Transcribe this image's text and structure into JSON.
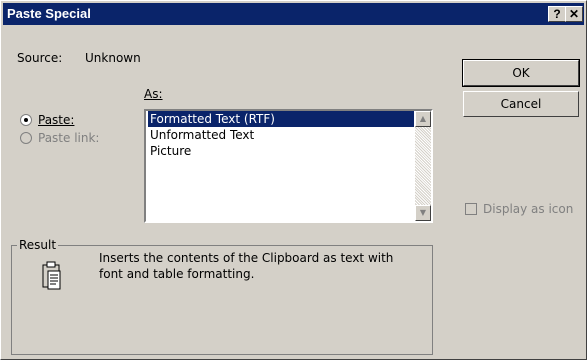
{
  "window": {
    "title": "Paste Special",
    "help_glyph": "?",
    "close_glyph": "✕"
  },
  "source": {
    "label": "Source:",
    "value": "Unknown"
  },
  "as_label": "As:",
  "options": {
    "paste": "Paste:",
    "paste_link": "Paste link:",
    "selected": "paste"
  },
  "formats": [
    "Formatted Text (RTF)",
    "Unformatted Text",
    "Picture"
  ],
  "selected_format": "Formatted Text (RTF)",
  "buttons": {
    "ok": "OK",
    "cancel": "Cancel"
  },
  "display_as_icon": {
    "label": "Display as icon",
    "checked": false,
    "enabled": false
  },
  "result": {
    "legend": "Result",
    "text": "Inserts the contents of the Clipboard as text with font and table formatting.",
    "icon": "clipboard-icon"
  },
  "colors": {
    "title_bar": "#0a246a",
    "face": "#d4d0c8",
    "selection": "#0a246a"
  }
}
